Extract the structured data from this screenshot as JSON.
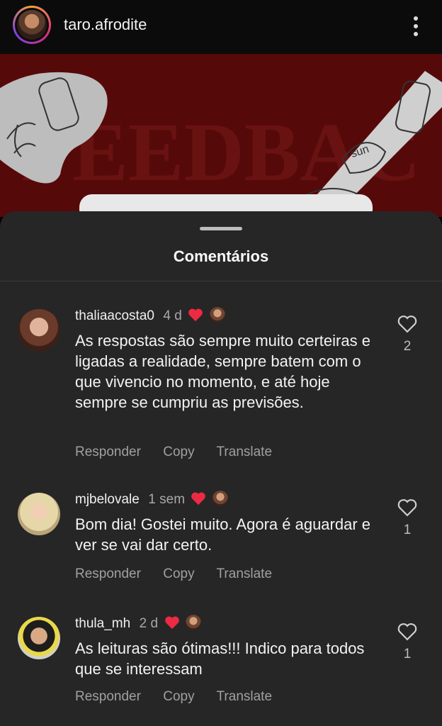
{
  "header": {
    "username": "taro.afrodite"
  },
  "banner": {
    "text": "FEEDBAC",
    "sticker": "sun"
  },
  "sheet": {
    "title": "Comentários"
  },
  "comments": [
    {
      "username": "thaliaacosta0",
      "time": "4 d",
      "text": "As respostas são sempre muito certeiras e ligadas a realidade, sempre batem com o que vivencio no momento, e até hoje sempre se cumpriu as previsões.",
      "likes": "2",
      "actions": {
        "reply": "Responder",
        "copy": "Copy",
        "translate": "Translate"
      }
    },
    {
      "username": "mjbelovale",
      "time": "1 sem",
      "text": "Bom dia! Gostei muito. Agora é aguardar e ver se vai dar certo.",
      "likes": "1",
      "actions": {
        "reply": "Responder",
        "copy": "Copy",
        "translate": "Translate"
      }
    },
    {
      "username": "thula_mh",
      "time": "2 d",
      "text": "As leituras são ótimas!!! Indico para todos que se interessam",
      "likes": "1",
      "actions": {
        "reply": "Responder",
        "copy": "Copy",
        "translate": "Translate"
      }
    }
  ],
  "colors": {
    "sheet": "#262626",
    "heart": "#ed2a44",
    "banner": "#5a0a0a"
  }
}
